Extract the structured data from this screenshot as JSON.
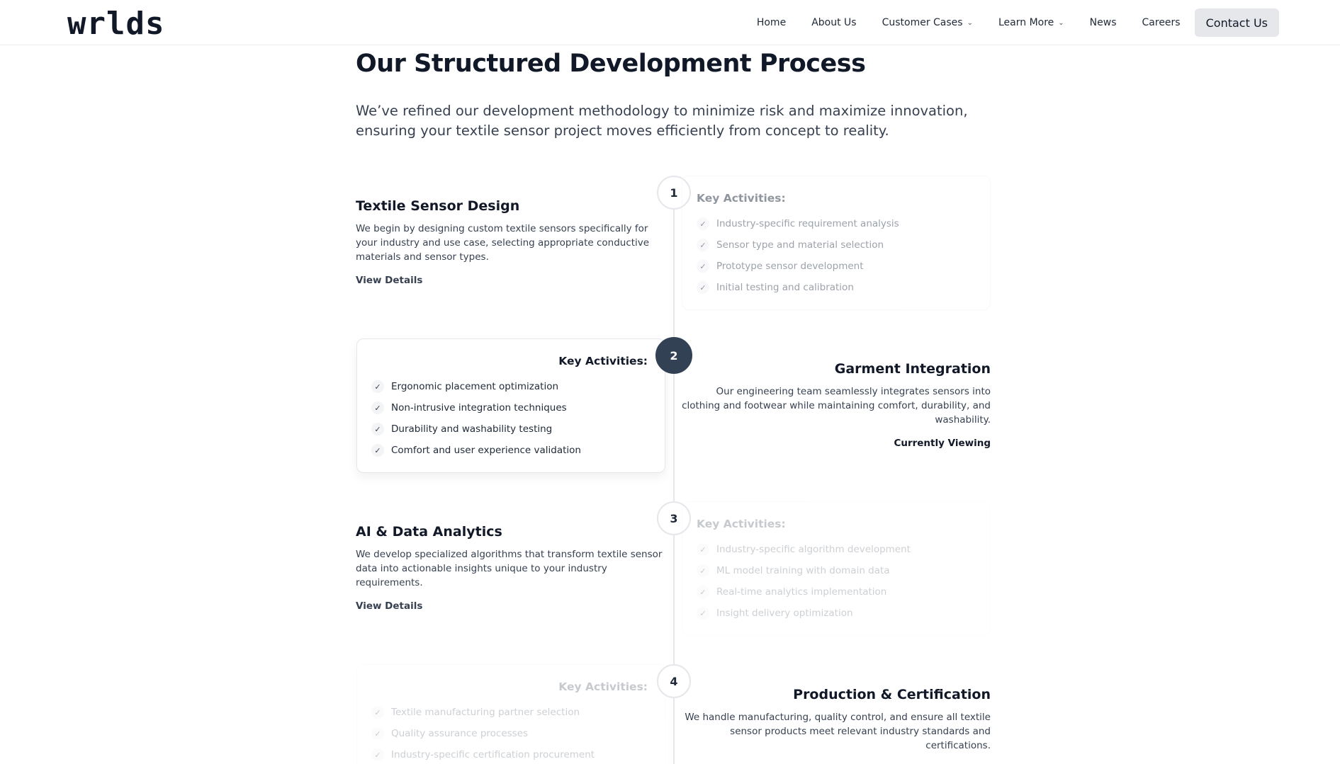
{
  "brand": {
    "logo": "wrlds"
  },
  "nav": {
    "items": [
      {
        "label": "Home"
      },
      {
        "label": "About Us"
      },
      {
        "label": "Customer Cases",
        "dropdown": true
      },
      {
        "label": "Learn More",
        "dropdown": true
      },
      {
        "label": "News"
      },
      {
        "label": "Careers"
      }
    ],
    "contact": "Contact Us"
  },
  "section": {
    "title": "Our Structured Development Process",
    "subtitle": "We’ve refined our development methodology to minimize risk and maximize innovation, ensuring your textile sensor project moves efficiently from concept to reality."
  },
  "steps": [
    {
      "number": "1",
      "title": "Textile Sensor Design",
      "description": "We begin by designing custom textile sensors specifically for your industry and use case, selecting appropriate conductive materials and sensor types.",
      "link": "View Details",
      "activities_title": "Key Activities:",
      "activities": [
        "Industry-specific requirement analysis",
        "Sensor type and material selection",
        "Prototype sensor development",
        "Initial testing and calibration"
      ]
    },
    {
      "number": "2",
      "title": "Garment Integration",
      "description": "Our engineering team seamlessly integrates sensors into clothing and footwear while maintaining comfort, durability, and washability.",
      "link": "Currently Viewing",
      "activities_title": "Key Activities:",
      "activities": [
        "Ergonomic placement optimization",
        "Non-intrusive integration techniques",
        "Durability and washability testing",
        "Comfort and user experience validation"
      ]
    },
    {
      "number": "3",
      "title": "AI & Data Analytics",
      "description": "We develop specialized algorithms that transform textile sensor data into actionable insights unique to your industry requirements.",
      "link": "View Details",
      "activities_title": "Key Activities:",
      "activities": [
        "Industry-specific algorithm development",
        "ML model training with domain data",
        "Real-time analytics implementation",
        "Insight delivery optimization"
      ]
    },
    {
      "number": "4",
      "title": "Production & Certification",
      "description": "We handle manufacturing, quality control, and ensure all textile sensor products meet relevant industry standards and certifications.",
      "activities_title": "Key Activities:",
      "activities": [
        "Textile manufacturing partner selection",
        "Quality assurance processes",
        "Industry-specific certification procurement"
      ]
    }
  ]
}
